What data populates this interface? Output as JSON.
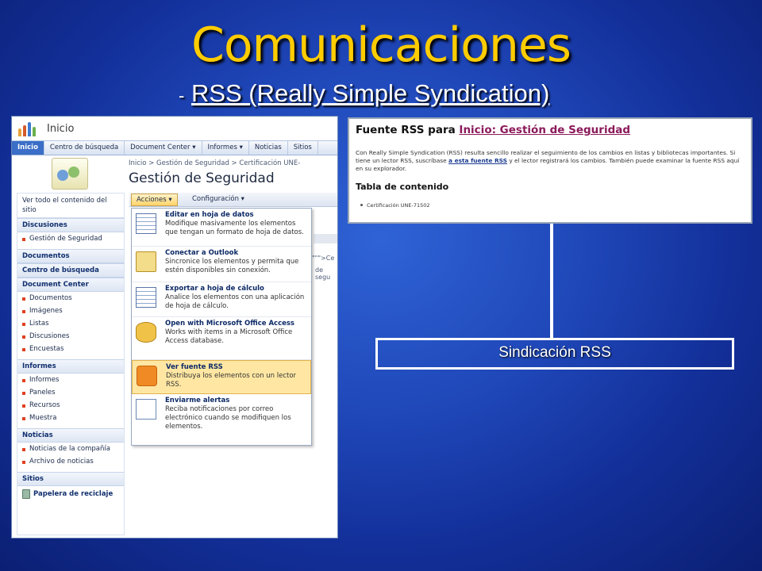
{
  "slide": {
    "title": "Comunicaciones",
    "subtitle_dash": "-",
    "subtitle": "RSS (Really  Simple Syndication)",
    "label_box": "Sindicación RSS"
  },
  "sharepoint": {
    "site_name": "Inicio",
    "tabs": [
      "Inicio",
      "Centro de búsqueda",
      "Document Center ▾",
      "Informes ▾",
      "Noticias",
      "Sitios"
    ],
    "breadcrumb": "Inicio > Gestión de Seguridad > Certificación UNE-",
    "page_title": "Gestión de Seguridad",
    "toolbar": {
      "actions": "Acciones ▾",
      "config": "Configuración ▾"
    },
    "behind_text_1": "\"\"\">Ce",
    "behind_text_2": "de segu",
    "nav": {
      "view_all": "Ver todo el contenido del sitio",
      "sections": [
        {
          "header": "Discusiones",
          "items": [
            "Gestión de Seguridad"
          ]
        },
        {
          "header": "Documentos",
          "items": []
        },
        {
          "header": "Centro de búsqueda",
          "items": []
        },
        {
          "header": "Document Center",
          "items": [
            "Documentos",
            "Imágenes",
            "Listas",
            "Discusiones",
            "Encuestas"
          ]
        },
        {
          "header": "Informes",
          "items": [
            "Informes",
            "Paneles",
            "Recursos",
            "Muestra"
          ]
        },
        {
          "header": "Noticias",
          "items": [
            "Noticias de la compañía",
            "Archivo de noticias"
          ]
        },
        {
          "header": "Sitios",
          "items": []
        }
      ],
      "recycle": "Papelera de reciclaje"
    },
    "menu": [
      {
        "title": "Editar en hoja de datos",
        "desc": "Modifique masivamente los elementos que tengan un formato de hoja de datos.",
        "icon": "datasheet-icon"
      },
      {
        "title": "Conectar a Outlook",
        "desc": "Sincronice los elementos y permita que estén disponibles sin conexión.",
        "icon": "outlook-icon"
      },
      {
        "title": "Exportar a hoja de cálculo",
        "desc": "Analice los elementos con una aplicación de hoja de cálculo.",
        "icon": "spreadsheet-icon"
      },
      {
        "title": "Open with Microsoft Office Access",
        "desc": "Works with items in a Microsoft Office Access database.",
        "icon": "access-icon"
      },
      {
        "title": "Ver fuente RSS",
        "desc": "Distribuya los elementos con un lector RSS.",
        "icon": "rss-icon"
      },
      {
        "title": "Enviarme alertas",
        "desc": "Reciba notificaciones por correo electrónico cuando se modifiquen los elementos.",
        "icon": "alert-mail-icon"
      }
    ]
  },
  "rss_panel": {
    "title_prefix": "Fuente RSS para",
    "title_link": "Inicio: Gestión de Seguridad",
    "desc_1": "Con Really Simple Syndication (RSS) resulta sencillo realizar el seguimiento de los cambios en listas y bibliotecas importantes. Si tiene un lector RSS, suscríbase",
    "desc_link": "a esta fuente RSS",
    "desc_2": "y el lector registrará los cambios. También puede examinar la fuente RSS aquí en su explorador.",
    "toc_title": "Tabla de contenido",
    "toc_item": "Certificación UNE-71502"
  }
}
